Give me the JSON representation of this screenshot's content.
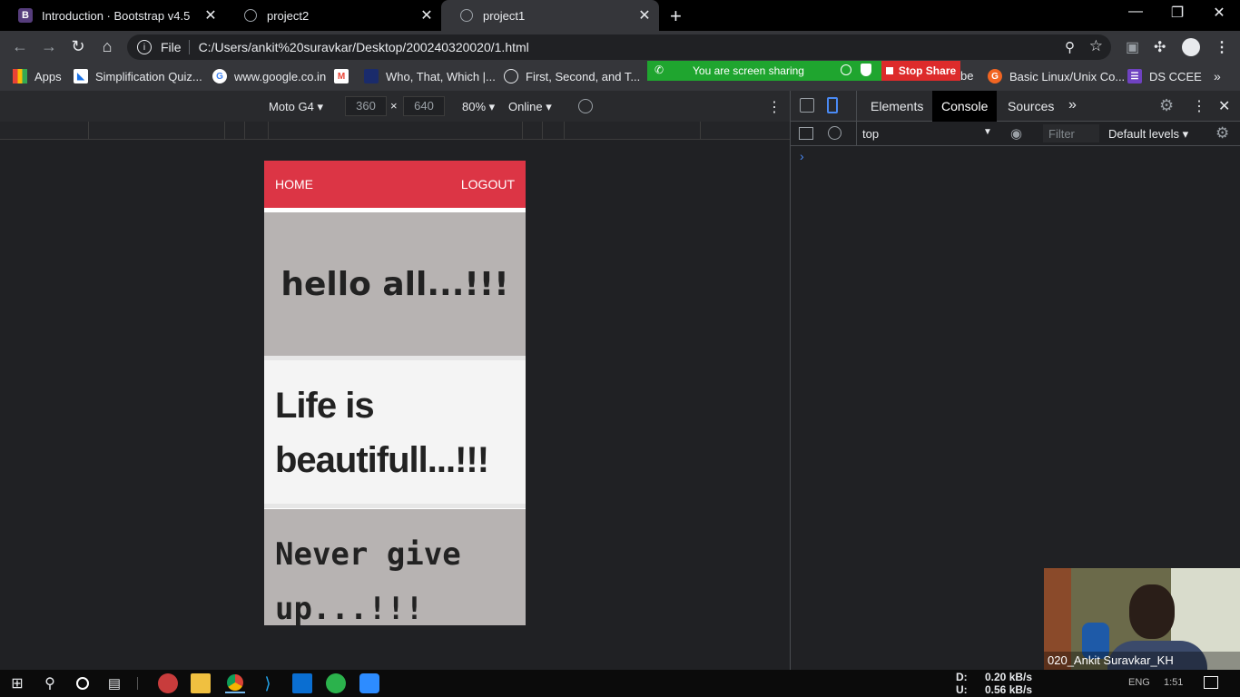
{
  "browser": {
    "tabs": [
      {
        "title": "Introduction · Bootstrap v4.5",
        "favicon": "B",
        "active": false
      },
      {
        "title": "project2",
        "active": false
      },
      {
        "title": "project1",
        "active": true
      }
    ],
    "address": {
      "scheme": "File",
      "url": "C:/Users/ankit%20suravkar/Desktop/200240320020/1.html"
    },
    "bookmarks": [
      {
        "label": "Apps"
      },
      {
        "label": "Simplification Quiz..."
      },
      {
        "label": "www.google.co.in"
      },
      {
        "label": "Who, That, Which |..."
      },
      {
        "label": "First, Second, and T..."
      },
      {
        "label": "be"
      },
      {
        "label": "Basic Linux/Unix Co..."
      },
      {
        "label": "DS CCEE"
      }
    ]
  },
  "screen_share": {
    "status": "You are screen sharing",
    "stop_label": "Stop Share"
  },
  "device_toolbar": {
    "device": "Moto G4",
    "width": "360",
    "height": "640",
    "times": "×",
    "zoom": "80%",
    "network": "Online"
  },
  "page": {
    "nav": {
      "home": "HOME",
      "logout": "LOGOUT"
    },
    "card1": "hello all...!!!",
    "card2_line1": "Life is",
    "card2_line2": "beautifull...!!!",
    "card3_line1": "Never give",
    "card3_line2": "up...!!!"
  },
  "devtools": {
    "tabs": [
      "Elements",
      "Console",
      "Sources"
    ],
    "active_tab": "Console",
    "context": "top",
    "filter_placeholder": "Filter",
    "levels": "Default levels",
    "prompt": "›"
  },
  "webcam": {
    "name": "020_Ankit Suravkar_KH"
  },
  "taskbar": {
    "net_down_label": "D:",
    "net_down": "0.20 kB/s",
    "net_up_label": "U:",
    "net_up": "0.56 kB/s",
    "lang": "ENG",
    "time": "1:51"
  },
  "colors": {
    "navbar": "#dc3545",
    "card_gray": "#b7b3b2",
    "share_green": "#1fa52f",
    "share_red": "#dd2b2b"
  }
}
